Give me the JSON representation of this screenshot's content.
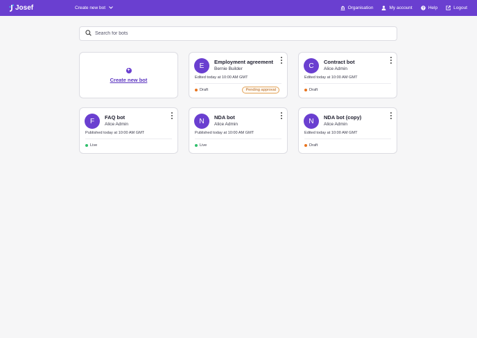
{
  "header": {
    "logo_text": "Josef",
    "create_menu_label": "Create new bot",
    "nav": [
      {
        "label": "Organisation",
        "icon": "bank-icon"
      },
      {
        "label": "My account",
        "icon": "user-icon"
      },
      {
        "label": "Help",
        "icon": "help-circle-icon"
      },
      {
        "label": "Logout",
        "icon": "logout-icon"
      }
    ]
  },
  "search": {
    "placeholder": "Search for bots",
    "value": ""
  },
  "create_card": {
    "label": "Create new bot",
    "icon": "plus-circle-icon"
  },
  "bots": [
    {
      "initial": "E",
      "name": "Employment agreement",
      "owner": "Bernie Builder",
      "meta": "Edited today at 10:00 AM GMT",
      "status": "Draft",
      "badge": "Pending approval"
    },
    {
      "initial": "C",
      "name": "Contract bot",
      "owner": "Alice Admin",
      "meta": "Edited today at 10:00 AM GMT",
      "status": "Draft",
      "badge": ""
    },
    {
      "initial": "F",
      "name": "FAQ bot",
      "owner": "Alice Admin",
      "meta": "Published today at 10:00 AM GMT",
      "status": "Live",
      "badge": ""
    },
    {
      "initial": "N",
      "name": "NDA bot",
      "owner": "Alice Admin",
      "meta": "Published today at 10:00 AM GMT",
      "status": "Live",
      "badge": ""
    },
    {
      "initial": "N",
      "name": "NDA bot (copy)",
      "owner": "Alice Admin",
      "meta": "Edited today at 10:00 AM GMT",
      "status": "Draft",
      "badge": ""
    }
  ],
  "colors": {
    "brand": "#6a3fd0",
    "draft": "#e8731c",
    "live": "#2fbf6b",
    "badge": "#b5651d"
  }
}
